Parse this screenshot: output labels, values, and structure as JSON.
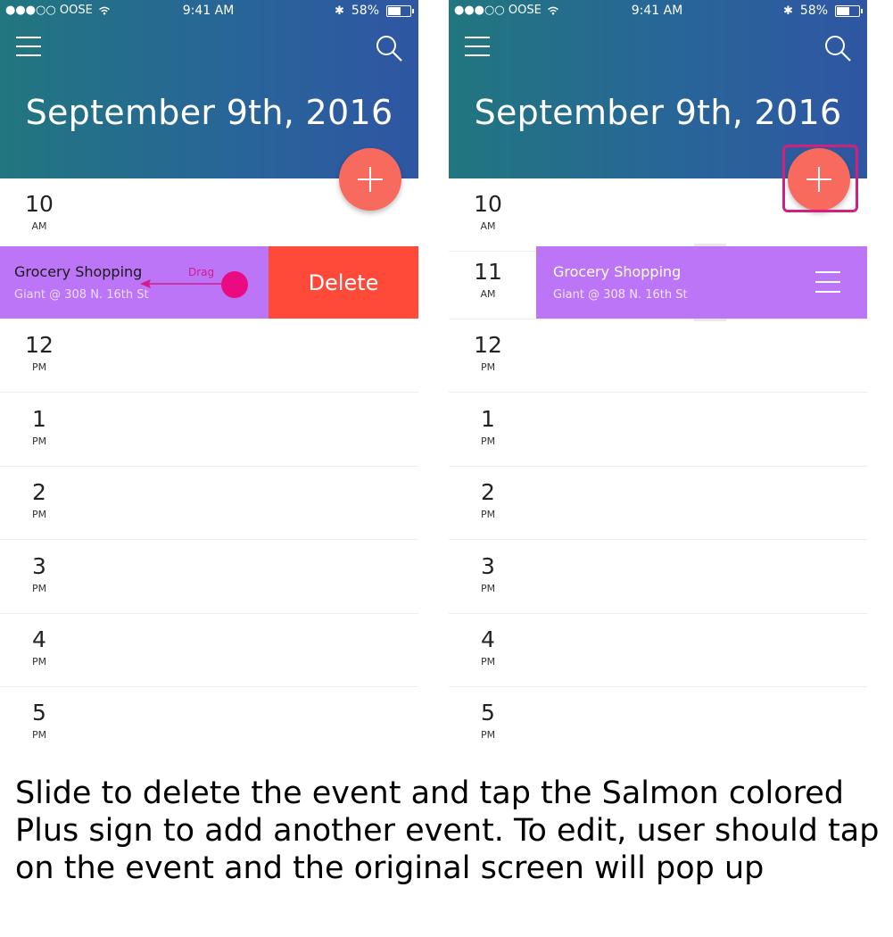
{
  "status_bar": {
    "carrier": "●●●○○ OOSE",
    "time": "9:41 AM",
    "battery": "58%",
    "battery_fraction": 0.58
  },
  "header": {
    "date": "September 9th, 2016",
    "menu_icon": "hamburger-menu-icon",
    "search_icon": "search-icon"
  },
  "fab": {
    "icon": "plus-icon",
    "color": "#f86a5d"
  },
  "left_screen": {
    "hours": [
      {
        "num": "10",
        "ampm": "AM"
      },
      {
        "num": "12",
        "ampm": "PM"
      },
      {
        "num": "1",
        "ampm": "PM"
      },
      {
        "num": "2",
        "ampm": "PM"
      },
      {
        "num": "3",
        "ampm": "PM"
      },
      {
        "num": "4",
        "ampm": "PM"
      },
      {
        "num": "5",
        "ampm": "PM"
      }
    ],
    "event": {
      "title": "Grocery Shopping",
      "location": "Giant @ 308 N. 16th St"
    },
    "delete_label": "Delete",
    "drag_label": "Drag"
  },
  "right_screen": {
    "hours": [
      {
        "num": "10",
        "ampm": "AM"
      },
      {
        "num": "11",
        "ampm": "AM"
      },
      {
        "num": "12",
        "ampm": "PM"
      },
      {
        "num": "1",
        "ampm": "PM"
      },
      {
        "num": "2",
        "ampm": "PM"
      },
      {
        "num": "3",
        "ampm": "PM"
      },
      {
        "num": "4",
        "ampm": "PM"
      },
      {
        "num": "5",
        "ampm": "PM"
      }
    ],
    "event": {
      "title": "Grocery Shopping",
      "location": "Giant @ 308 N. 16th St"
    }
  },
  "caption": "Slide to delete the event and tap the Salmon colored Plus sign to add another event. To edit, user should tap on the event and the original screen will pop up",
  "colors": {
    "header_start": "#21767f",
    "header_end": "#2f56a3",
    "event": "#bb75f6",
    "delete": "#ff4a3a",
    "annotation": "#ea0b82",
    "highlight": "#d3207d"
  }
}
